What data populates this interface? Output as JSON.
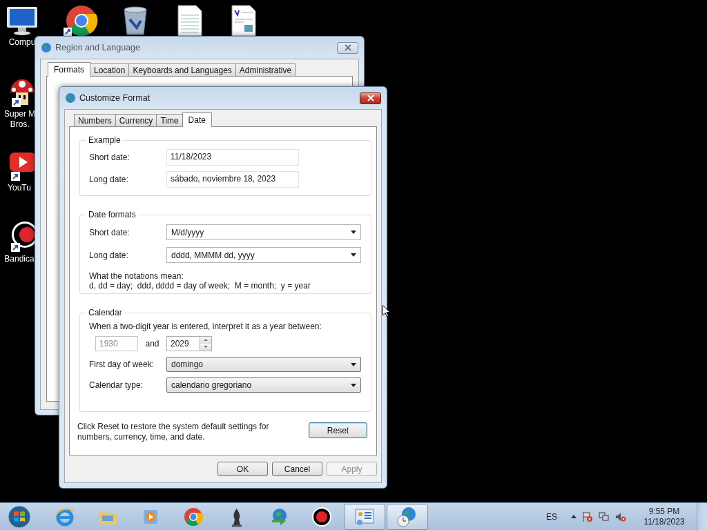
{
  "desktop_icons": [
    {
      "kind": "computer",
      "label": "Compu"
    },
    {
      "kind": "chrome"
    },
    {
      "kind": "recycle"
    },
    {
      "kind": "textdoc"
    },
    {
      "kind": "richdoc"
    },
    {
      "kind": "mushroom",
      "label": "Super M\nBros."
    },
    {
      "kind": "youtube",
      "label": "YouTu"
    },
    {
      "kind": "record",
      "label": "Bandica"
    }
  ],
  "region_window": {
    "title": "Region and Language",
    "tabs": [
      {
        "label": "Formats",
        "selected": true
      },
      {
        "label": "Location",
        "selected": false
      },
      {
        "label": "Keyboards and Languages",
        "selected": false
      },
      {
        "label": "Administrative",
        "selected": false
      }
    ]
  },
  "dialog": {
    "title": "Customize Format",
    "tabs": [
      {
        "label": "Numbers",
        "selected": false
      },
      {
        "label": "Currency",
        "selected": false
      },
      {
        "label": "Time",
        "selected": false
      },
      {
        "label": "Date",
        "selected": true
      }
    ],
    "example": {
      "title": "Example",
      "rows": [
        {
          "label": "Short date:",
          "value": "11/18/2023"
        },
        {
          "label": "Long date:",
          "value": "sábado, noviembre 18, 2023"
        }
      ]
    },
    "date_formats": {
      "title": "Date formats",
      "rows": [
        {
          "label": "Short date:",
          "value": "M/d/yyyy"
        },
        {
          "label": "Long date:",
          "value": "dddd, MMMM dd, yyyy"
        }
      ],
      "notation_title": "What the notations mean:",
      "notation_text": "d, dd = day;  ddd, dddd = day of week;  M = month;  y = year"
    },
    "calendar": {
      "title": "Calendar",
      "two_digit_label": "When a two-digit year is entered, interpret it as a year between:",
      "year_from": {
        "value": "1930",
        "disabled": true
      },
      "and_label": "and",
      "year_to": "2029",
      "rows": [
        {
          "label": "First day of week:",
          "value": "domingo"
        },
        {
          "label": "Calendar type:",
          "value": "calendario gregoriano"
        }
      ]
    },
    "reset_note": "Click Reset to restore the system default settings for numbers, currency, time, and date.",
    "reset_button": "Reset",
    "buttons": [
      {
        "label": "OK",
        "disabled": false
      },
      {
        "label": "Cancel",
        "disabled": false
      },
      {
        "label": "Apply",
        "disabled": true
      }
    ]
  },
  "taskbar": {
    "items": [
      {
        "kind": "ie",
        "active": false
      },
      {
        "kind": "folder",
        "active": false
      },
      {
        "kind": "media",
        "active": false
      },
      {
        "kind": "chrome",
        "active": false
      },
      {
        "kind": "chess",
        "active": false
      },
      {
        "kind": "download",
        "active": false
      },
      {
        "kind": "record",
        "active": false
      },
      {
        "kind": "panel",
        "active": true
      },
      {
        "kind": "globe",
        "active": true
      }
    ],
    "language": "ES",
    "time": "9:55 PM",
    "date": "11/18/2023"
  }
}
